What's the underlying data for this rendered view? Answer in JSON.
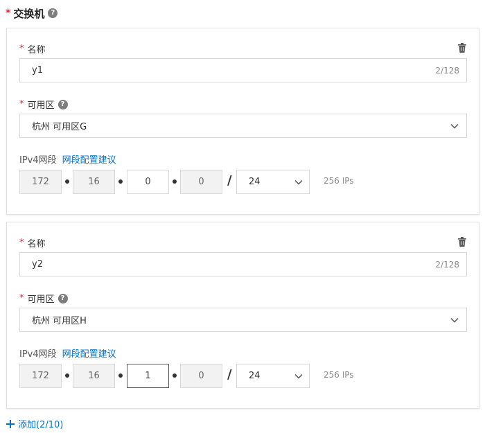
{
  "header": {
    "required_mark": "*",
    "title": "交换机",
    "help_glyph": "?"
  },
  "switches": [
    {
      "name_label": "名称",
      "name_value": "y1",
      "name_counter": "2/128",
      "zone_label": "可用区",
      "zone_value": "杭州 可用区G",
      "ipv4_label": "IPv4网段",
      "advice_link": "网段配置建议",
      "octets": [
        "172",
        "16",
        "0",
        "0"
      ],
      "mask": "24",
      "ip_count": "256 IPs"
    },
    {
      "name_label": "名称",
      "name_value": "y2",
      "name_counter": "2/128",
      "zone_label": "可用区",
      "zone_value": "杭州 可用区H",
      "ipv4_label": "IPv4网段",
      "advice_link": "网段配置建议",
      "octets": [
        "172",
        "16",
        "1",
        "0"
      ],
      "mask": "24",
      "ip_count": "256 IPs"
    }
  ],
  "footer": {
    "add_label": "添加(2/10)"
  },
  "icons": {
    "help": "help-icon",
    "trash": "trash-icon",
    "chevron": "chevron-down-icon",
    "add": "plus-icon"
  },
  "colors": {
    "required": "#f5222d",
    "link": "#0070cc",
    "border": "#d9d9d9",
    "disabled_bg": "#f2f2f2"
  }
}
